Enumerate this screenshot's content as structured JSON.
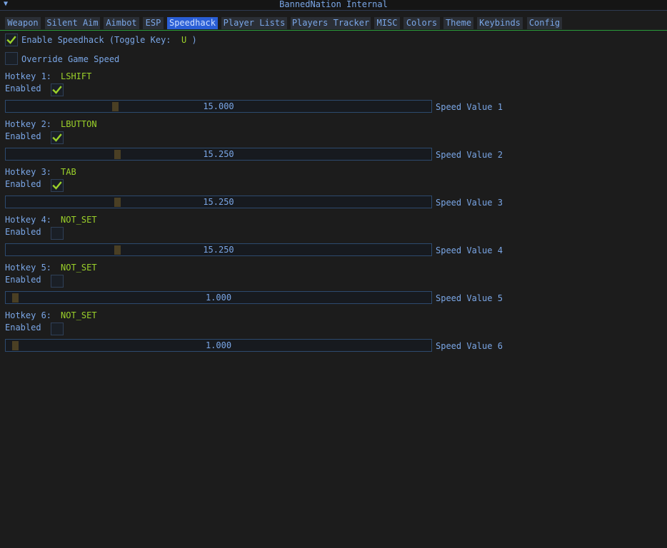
{
  "window": {
    "title": "BannedNation Internal",
    "collapse_icon": "triangle-down-icon"
  },
  "tabs": [
    {
      "label": "Weapon",
      "active": false
    },
    {
      "label": "Silent Aim",
      "active": false
    },
    {
      "label": "Aimbot",
      "active": false
    },
    {
      "label": "ESP",
      "active": false
    },
    {
      "label": "Speedhack",
      "active": true
    },
    {
      "label": "Player Lists",
      "active": false
    },
    {
      "label": "Players Tracker",
      "active": false
    },
    {
      "label": "MISC",
      "active": false
    },
    {
      "label": "Colors",
      "active": false
    },
    {
      "label": "Theme",
      "active": false
    },
    {
      "label": "Keybinds",
      "active": false
    },
    {
      "label": "Config",
      "active": false
    }
  ],
  "speedhack": {
    "enable_label": "Enable Speedhack (Toggle Key:",
    "toggle_key": "U",
    "enable_close": ")",
    "enable_checked": true,
    "override_label": "Override Game Speed",
    "override_checked": false,
    "enabled_label": "Enabled",
    "hotkeys": [
      {
        "label": "Hotkey 1:",
        "key": "LSHIFT",
        "enabled": true,
        "value": "15.000",
        "fraction": 0.24,
        "slider_label": "Speed Value 1"
      },
      {
        "label": "Hotkey 2:",
        "key": "LBUTTON",
        "enabled": true,
        "value": "15.250",
        "fraction": 0.245,
        "slider_label": "Speed Value 2"
      },
      {
        "label": "Hotkey 3:",
        "key": "TAB",
        "enabled": true,
        "value": "15.250",
        "fraction": 0.245,
        "slider_label": "Speed Value 3"
      },
      {
        "label": "Hotkey 4:",
        "key": "NOT_SET",
        "enabled": false,
        "value": "15.250",
        "fraction": 0.245,
        "slider_label": "Speed Value 4"
      },
      {
        "label": "Hotkey 5:",
        "key": "NOT_SET",
        "enabled": false,
        "value": "1.000",
        "fraction": 0.0,
        "slider_label": "Speed Value 5"
      },
      {
        "label": "Hotkey 6:",
        "key": "NOT_SET",
        "enabled": false,
        "value": "1.000",
        "fraction": 0.0,
        "slider_label": "Speed Value 6"
      }
    ]
  },
  "colors": {
    "accent": "#2a5ed6",
    "text": "#7aa6e6",
    "key_text": "#9bd12a",
    "check": "#9bd12a",
    "separator": "#2a9c3a"
  }
}
